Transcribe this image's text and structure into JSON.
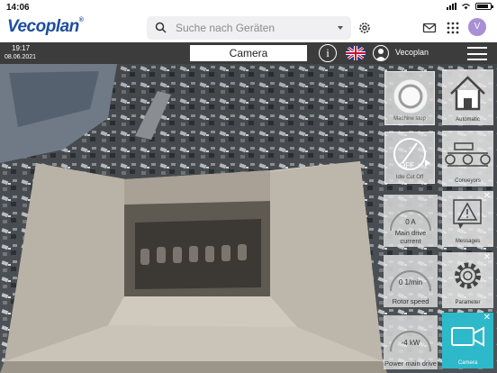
{
  "status_bar": {
    "time": "14:06"
  },
  "header": {
    "logo": "Vecoplan",
    "logo_mark": "®",
    "search": {
      "placeholder": "Suche nach Geräten"
    },
    "avatar_initial": "V"
  },
  "toolbar": {
    "time": "19:17",
    "date": "08.06.2021",
    "title": "Camera",
    "info_glyph": "i",
    "username": "Vecoplan",
    "language_flag": "uk-flag-icon"
  },
  "machine_controls": [
    {
      "label": "Machine stop",
      "icon": "machine-stop-icon"
    },
    {
      "label": "Idle Cut Off",
      "value": "OFF",
      "icon": "dial-icon"
    }
  ],
  "gauges": [
    {
      "value": "0 A",
      "label": "Main drive current"
    },
    {
      "value": "0 1/min",
      "label": "Rotor speed"
    },
    {
      "value": "-4 kW",
      "label": "Power main drive"
    }
  ],
  "nav": [
    {
      "label": "Automatic",
      "icon": "home-icon",
      "closable": false,
      "active": false
    },
    {
      "label": "Conveyors",
      "icon": "conveyor-icon",
      "closable": false,
      "active": false
    },
    {
      "label": "Messages",
      "icon": "warning-icon",
      "closable": true,
      "active": false
    },
    {
      "label": "Parameter",
      "icon": "gear-icon",
      "closable": true,
      "active": false
    },
    {
      "label": "Camera",
      "icon": "camera-icon",
      "closable": true,
      "active": true
    }
  ],
  "close_glyph": "✕",
  "colors": {
    "brand": "#1d4e9e",
    "toolbar": "#3c3c3c",
    "active_tile": "#2db9c9",
    "avatar": "#a98fd3"
  }
}
